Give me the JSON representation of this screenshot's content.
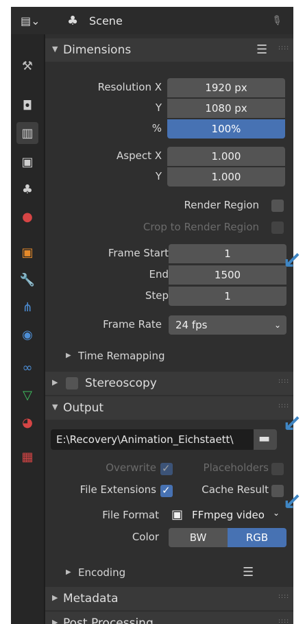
{
  "header": {
    "editor_type_icon": "hamburger-editor-icon",
    "title": "Scene",
    "pin_icon": "pin-icon"
  },
  "tabs": [
    "tool",
    "render",
    "output",
    "view-layer",
    "scene",
    "world",
    "object",
    "modifier",
    "particles",
    "physics",
    "constraints",
    "data",
    "material",
    "texture"
  ],
  "dimensions": {
    "title": "Dimensions",
    "resolution_x_label": "Resolution X",
    "resolution_x": "1920 px",
    "resolution_y_label": "Y",
    "resolution_y": "1080 px",
    "percent_label": "%",
    "percent": "100%",
    "aspect_x_label": "Aspect X",
    "aspect_x": "1.000",
    "aspect_y_label": "Y",
    "aspect_y": "1.000",
    "render_region": "Render Region",
    "crop_region": "Crop to Render Region",
    "frame_start_label": "Frame Start",
    "frame_start": "1",
    "end_label": "End",
    "end": "1500",
    "step_label": "Step",
    "step": "1",
    "frame_rate_label": "Frame Rate",
    "frame_rate": "24 fps",
    "time_remapping": "Time Remapping"
  },
  "stereoscopy": {
    "title": "Stereoscopy"
  },
  "output": {
    "title": "Output",
    "path": "E:\\Recovery\\Animation_Eichstaett\\",
    "overwrite": "Overwrite",
    "placeholders": "Placeholders",
    "file_extensions": "File Extensions",
    "cache_result": "Cache Result",
    "file_format_label": "File Format",
    "file_format": "FFmpeg video",
    "color_label": "Color",
    "color_bw": "BW",
    "color_rgb": "RGB",
    "encoding": "Encoding"
  },
  "metadata": {
    "title": "Metadata"
  },
  "post_processing": {
    "title": "Post Processing"
  }
}
